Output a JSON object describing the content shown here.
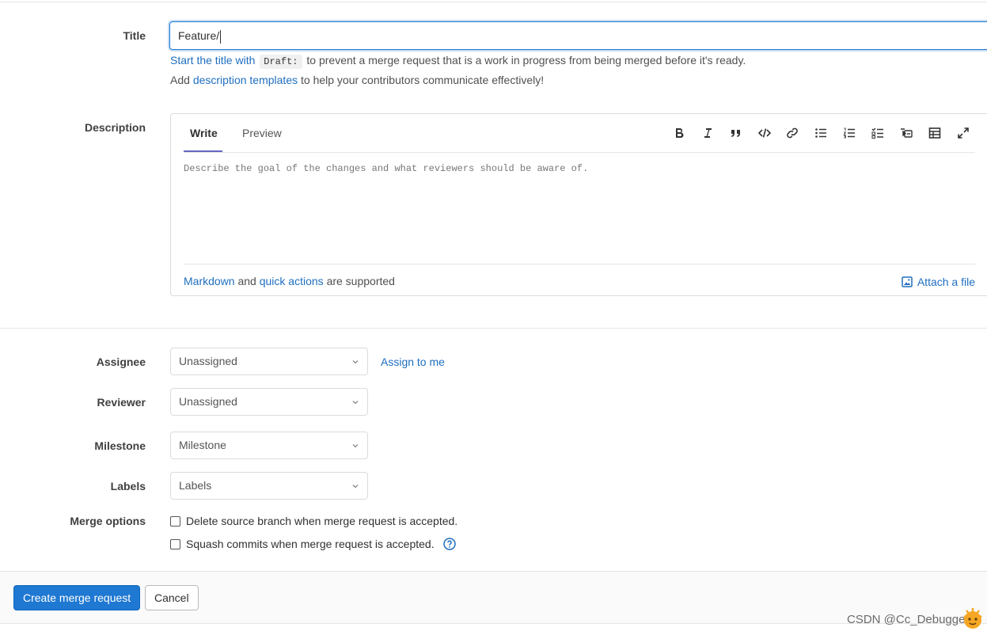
{
  "form": {
    "title_label": "Title",
    "title_value": "Feature/",
    "title_hint_link": "Start the title with",
    "title_hint_code": "Draft:",
    "title_hint_rest": "to prevent a merge request that is a work in progress from being merged before it's ready.",
    "templates_pre": "Add",
    "templates_link": "description templates",
    "templates_post": "to help your contributors communicate effectively!",
    "description_label": "Description"
  },
  "editor": {
    "tab_write": "Write",
    "tab_preview": "Preview",
    "placeholder": "Describe the goal of the changes and what reviewers should be aware of.",
    "markdown_link": "Markdown",
    "and_text": "and",
    "quick_actions_link": "quick actions",
    "supported_text": "are supported",
    "attach_label": "Attach a file",
    "toolbar": [
      "bold-icon",
      "italic-icon",
      "quote-icon",
      "code-icon",
      "link-icon",
      "bulleted-list-icon",
      "numbered-list-icon",
      "task-list-icon",
      "collapsible-section-icon",
      "table-icon",
      "fullscreen-icon"
    ]
  },
  "sidebar_fields": {
    "assignee_label": "Assignee",
    "assignee_value": "Unassigned",
    "assign_to_me": "Assign to me",
    "reviewer_label": "Reviewer",
    "reviewer_value": "Unassigned",
    "milestone_label": "Milestone",
    "milestone_value": "Milestone",
    "labels_label": "Labels",
    "labels_value": "Labels"
  },
  "merge_options": {
    "label": "Merge options",
    "delete_branch": "Delete source branch when merge request is accepted.",
    "squash_commits": "Squash commits when merge request is accepted."
  },
  "actions": {
    "create": "Create merge request",
    "cancel": "Cancel"
  },
  "watermark": "CSDN @Cc_Debugger",
  "colors": {
    "accent": "#1f78d1",
    "link": "#1f6fbf",
    "tab_underline": "#6666c4"
  }
}
